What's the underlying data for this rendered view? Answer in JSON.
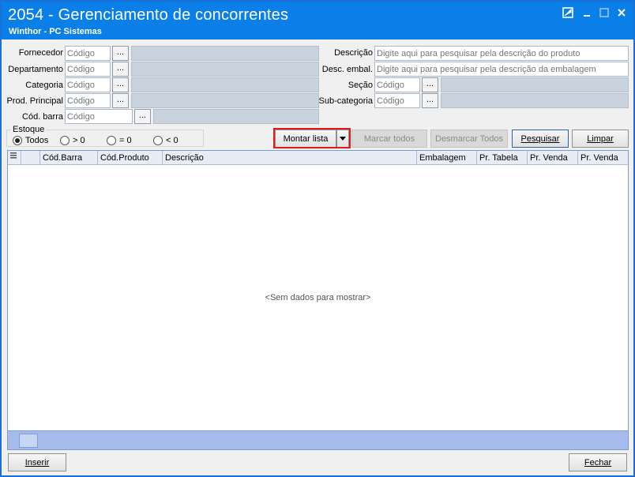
{
  "window": {
    "title": "2054 - Gerenciamento de concorrentes",
    "subtitle": "Winthor - PC Sistemas",
    "controls": [
      "restore-icon",
      "minimize-icon",
      "maximize-icon",
      "close-icon"
    ],
    "colors": {
      "titlebar": "#0b7fe8",
      "highlight": "#e01b1b"
    }
  },
  "filters": {
    "fornecedor": {
      "label": "Fornecedor",
      "placeholder": "Código",
      "button": "..."
    },
    "departamento": {
      "label": "Departamento",
      "placeholder": "Código",
      "button": "..."
    },
    "categoria": {
      "label": "Categoria",
      "placeholder": "Código",
      "button": "..."
    },
    "prod_principal": {
      "label": "Prod. Principal",
      "placeholder": "Código",
      "button": "..."
    },
    "cod_barra": {
      "label": "Cód. barra",
      "placeholder": "Código",
      "button": "..."
    },
    "descricao": {
      "label": "Descrição",
      "placeholder": "Digite aqui para pesquisar pela descrição do produto"
    },
    "desc_embal": {
      "label": "Desc. embal.",
      "placeholder": "Digite aqui para pesquisar pela descrição da embalagem"
    },
    "secao": {
      "label": "Seção",
      "placeholder": "Código",
      "button": "..."
    },
    "sub_categoria": {
      "label": "Sub-categoria",
      "placeholder": "Código",
      "button": "..."
    }
  },
  "estoque": {
    "title": "Estoque",
    "options": [
      "Todos",
      "> 0",
      "= 0",
      "< 0"
    ],
    "selected": "Todos"
  },
  "buttons": {
    "montar_lista": "Montar lista",
    "marcar_todos": "Marcar todos",
    "desmarcar_todos": "Desmarcar Todos",
    "pesquisar": "Pesquisar",
    "limpar": "Limpar",
    "inserir": "Inserir",
    "fechar": "Fechar"
  },
  "grid": {
    "columns": [
      "Cód.Barra",
      "Cód.Produto",
      "Descrição",
      "Embalagem",
      "Pr. Tabela",
      "Pr. Venda",
      "Pr. Venda"
    ],
    "empty_text": "<Sem dados para mostrar>"
  }
}
